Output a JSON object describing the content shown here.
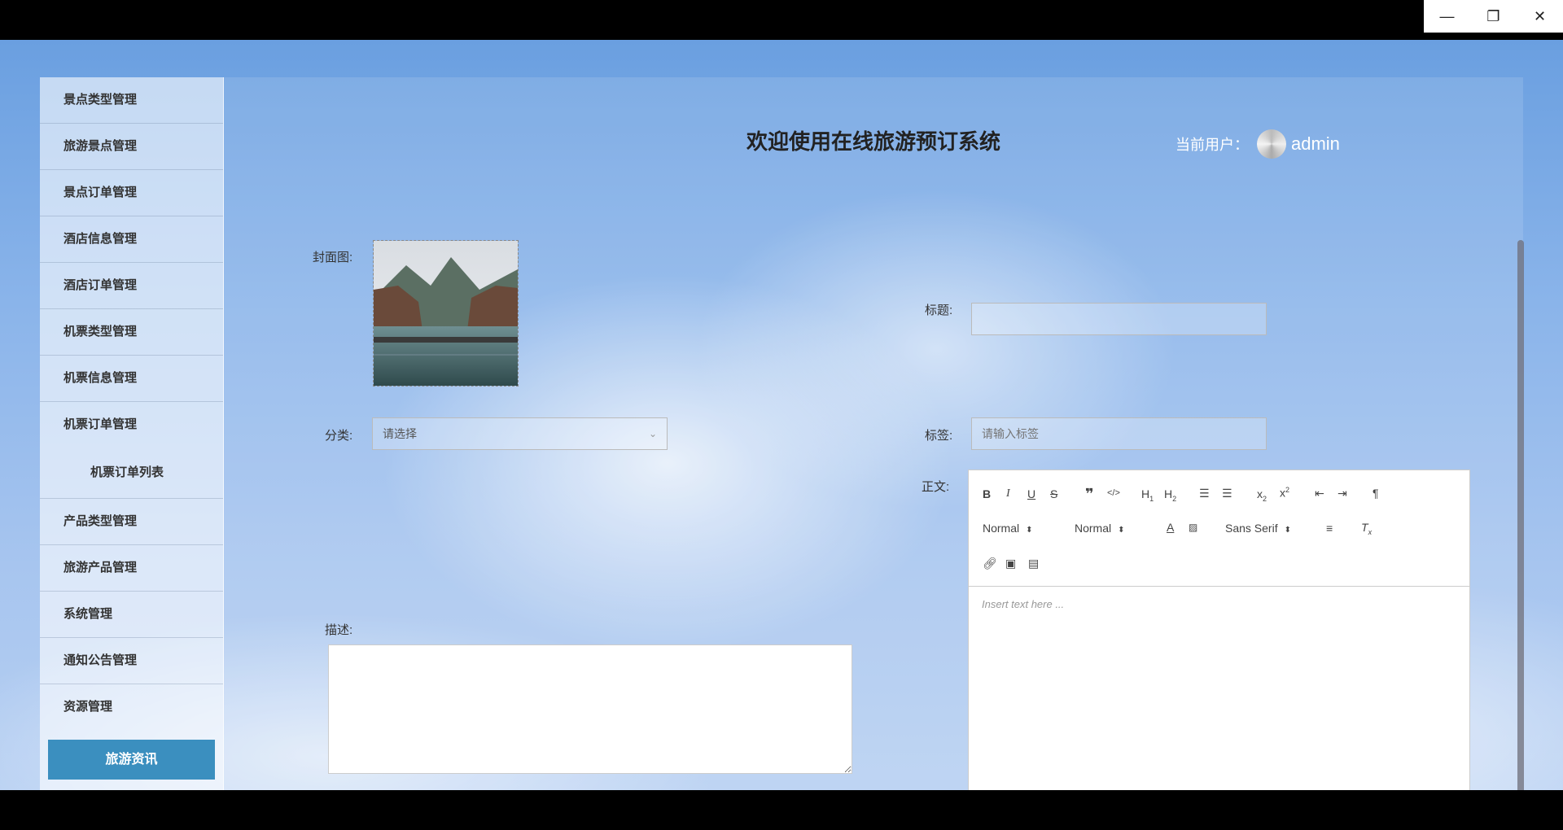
{
  "window": {
    "minimize_glyph": "—",
    "restore_glyph": "❐",
    "close_glyph": "✕"
  },
  "sidebar": {
    "items": [
      {
        "label": "景点类型管理"
      },
      {
        "label": "旅游景点管理"
      },
      {
        "label": "景点订单管理"
      },
      {
        "label": "酒店信息管理"
      },
      {
        "label": "酒店订单管理"
      },
      {
        "label": "机票类型管理"
      },
      {
        "label": "机票信息管理"
      },
      {
        "label": "机票订单管理"
      },
      {
        "label": "机票订单列表"
      },
      {
        "label": "产品类型管理"
      },
      {
        "label": "旅游产品管理"
      },
      {
        "label": "系统管理"
      },
      {
        "label": "通知公告管理"
      },
      {
        "label": "资源管理"
      }
    ],
    "active_label": "旅游资讯"
  },
  "header": {
    "title": "欢迎使用在线旅游预订系统",
    "user_label": "当前用户：",
    "user_name": "admin"
  },
  "form": {
    "cover_label": "封面图:",
    "title_label": "标题:",
    "title_value": "",
    "category_label": "分类:",
    "category_value": "请选择",
    "tags_label": "标签:",
    "tags_placeholder": "请输入标签",
    "content_label": "正文:",
    "desc_label": "描述:",
    "desc_value": ""
  },
  "editor": {
    "header_select": "Normal",
    "size_select": "Normal",
    "font_select": "Sans Serif",
    "placeholder": "Insert text here ..."
  },
  "colors": {
    "active_menu": "#3b8fbf",
    "sky_top": "#6a9fe0",
    "sky_bottom": "#b6cff2"
  }
}
